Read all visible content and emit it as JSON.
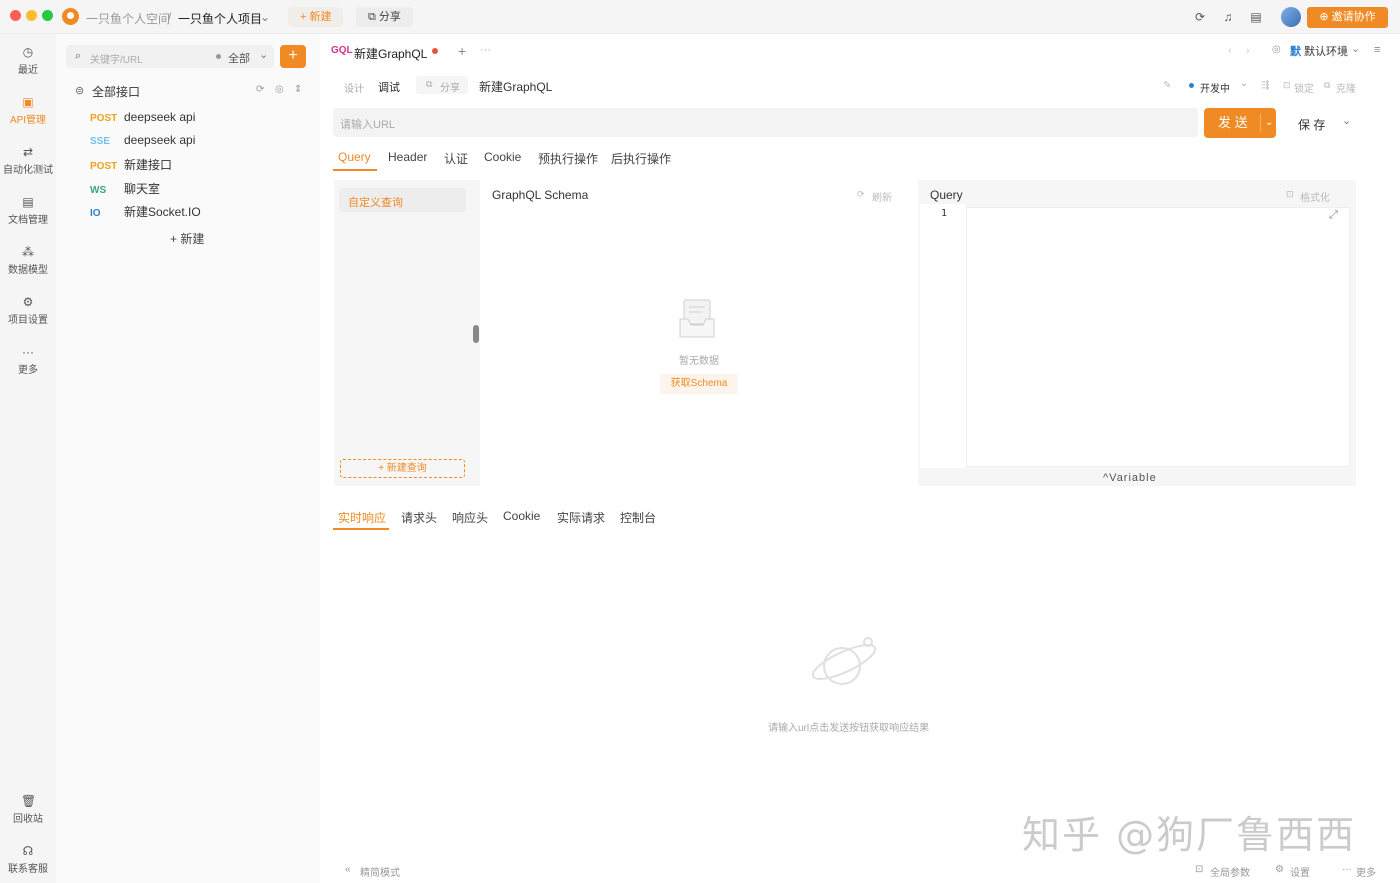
{
  "colors": {
    "accent": "#f08a24",
    "post": "#f0a020",
    "sse": "#6fc3e8",
    "ws": "#3aa57a",
    "io": "#2f7fd0",
    "gql": "#d9318e"
  },
  "topbar": {
    "space": "一只鱼个人空间",
    "separator": "/",
    "project": "一只鱼个人项目",
    "new_label": "新建",
    "share_label": "分享",
    "invite_label": "邀请协作"
  },
  "rail": [
    {
      "label": "最近",
      "icon": "history-icon"
    },
    {
      "label": "API管理",
      "icon": "api-icon",
      "active": true
    },
    {
      "label": "自动化测试",
      "icon": "automation-icon"
    },
    {
      "label": "文档管理",
      "icon": "document-icon"
    },
    {
      "label": "数据模型",
      "icon": "model-icon"
    },
    {
      "label": "项目设置",
      "icon": "settings-icon"
    },
    {
      "label": "更多",
      "icon": "more-icon"
    },
    {
      "label": "回收站",
      "icon": "trash-icon"
    },
    {
      "label": "联系客服",
      "icon": "headset-icon"
    }
  ],
  "sidebar": {
    "search_placeholder": "关键字/URL",
    "filter": "全部",
    "root": "全部接口",
    "items": [
      {
        "method": "POST",
        "name": "deepseek api"
      },
      {
        "method": "SSE",
        "name": "deepseek api"
      },
      {
        "method": "POST",
        "name": "新建接口"
      },
      {
        "method": "WS",
        "name": "聊天室"
      },
      {
        "method": "IO",
        "name": "新建Socket.IO"
      }
    ],
    "new_label": "新建"
  },
  "doc_tab": {
    "badge": "GQL",
    "title": "新建GraphQL"
  },
  "env": "默认环境",
  "subtabs": {
    "design": "设计",
    "debug": "调试",
    "share": "分享",
    "name": "新建GraphQL",
    "env_stage": "开发中",
    "lock": "锁定",
    "clone": "克隆"
  },
  "url_placeholder": "请输入URL",
  "send_label": "发 送",
  "save_label": "保 存",
  "req_tabs": [
    "Query",
    "Header",
    "认证",
    "Cookie",
    "预执行操作",
    "后执行操作"
  ],
  "query_panel": {
    "custom_query": "自定义查询",
    "new_query": "+ 新建查询",
    "schema_title": "GraphQL Schema",
    "refresh": "刷新",
    "empty": "暂无数据",
    "fetch_schema": "获取Schema",
    "query_title": "Query",
    "format": "格式化",
    "line_number": "1",
    "variable": "Variable"
  },
  "resp_tabs": [
    "实时响应",
    "请求头",
    "响应头",
    "Cookie",
    "实际请求",
    "控制台"
  ],
  "resp_empty": "请输入url点击发送按钮获取响应结果",
  "statusbar": {
    "simple_mode": "精简模式",
    "global_params": "全局参数",
    "settings": "设置",
    "more": "更多"
  },
  "watermark": "知乎 @狗厂鲁西西"
}
